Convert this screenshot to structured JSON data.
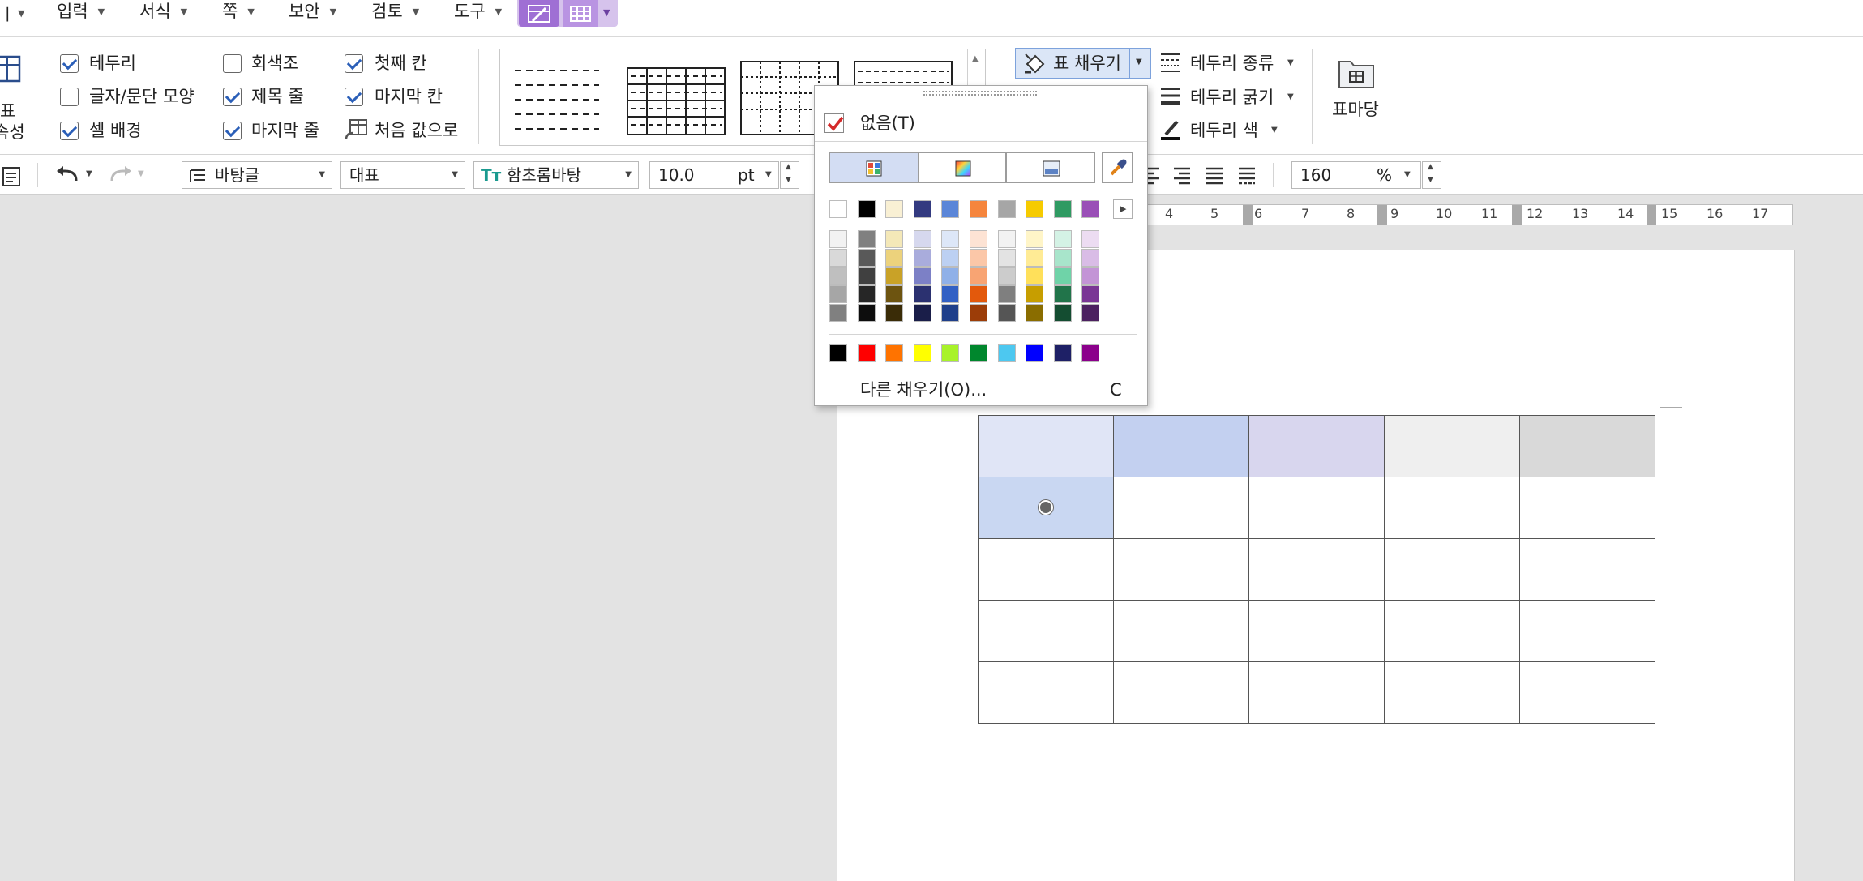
{
  "menu": {
    "items": [
      "입력",
      "서식",
      "쪽",
      "보안",
      "검토",
      "도구"
    ]
  },
  "ribbon": {
    "table_props_label_a": "표",
    "table_props_label_b": "속성",
    "checks": [
      {
        "label": "테두리",
        "checked": true
      },
      {
        "label": "글자/문단 모양",
        "checked": false
      },
      {
        "label": "셀 배경",
        "checked": true
      },
      {
        "label": "회색조",
        "checked": false
      },
      {
        "label": "제목 줄",
        "checked": true
      },
      {
        "label": "마지막 줄",
        "checked": true
      },
      {
        "label": "첫째 칸",
        "checked": true
      },
      {
        "label": "마지막 칸",
        "checked": true
      }
    ],
    "reset_label": "처음 값으로",
    "fill_label": "표 채우기",
    "border_type_label": "테두리 종류",
    "border_width_label": "테두리 굵기",
    "border_color_label": "테두리 색",
    "yard_label": "표마당"
  },
  "toolbar": {
    "style": "바탕글",
    "language": "대표",
    "font": "함초롬바탕",
    "size": "10.0",
    "size_unit": "pt",
    "zoom": "160",
    "zoom_unit": "%"
  },
  "ruler": {
    "labels": [
      "4",
      "5",
      "6",
      "7",
      "8",
      "9",
      "10",
      "11",
      "12",
      "13",
      "14",
      "15",
      "16",
      "17"
    ]
  },
  "popup": {
    "none_label": "없음(T)",
    "none_checked": true,
    "more_label": "다른 채우기(O)...",
    "more_shortcut": "C",
    "top_row": [
      "#ffffff",
      "#000000",
      "#f9f0d4",
      "#333a80",
      "#5b86d8",
      "#f5853d",
      "#a6a6a6",
      "#f6cb00",
      "#2f9a62",
      "#9a4fb7"
    ],
    "shade_columns": [
      [
        "#f2f2f2",
        "#d9d9d9",
        "#bfbfbf",
        "#a6a6a6",
        "#808080"
      ],
      [
        "#808080",
        "#595959",
        "#404040",
        "#262626",
        "#0d0d0d"
      ],
      [
        "#f4e8b8",
        "#ecd27c",
        "#c9a227",
        "#6d5410",
        "#3a2c07"
      ],
      [
        "#d6d8ee",
        "#a9acdc",
        "#7c80c6",
        "#2b3170",
        "#1a1e49"
      ],
      [
        "#dde7f8",
        "#bcd0f2",
        "#8fb0e8",
        "#3260c4",
        "#1f3f8a"
      ],
      [
        "#fde3d4",
        "#fbc7a8",
        "#f8a473",
        "#e3590c",
        "#9c3d08"
      ],
      [
        "#f2f2f2",
        "#e3e3e3",
        "#cccccc",
        "#7f7f7f",
        "#555555"
      ],
      [
        "#fff5c8",
        "#ffeb95",
        "#ffe05a",
        "#c79e00",
        "#8a6d00"
      ],
      [
        "#d4f2e5",
        "#a8e5cb",
        "#6fd3a8",
        "#21744a",
        "#144d31"
      ],
      [
        "#ecdcf2",
        "#d9bce6",
        "#c394d6",
        "#7a3595",
        "#4c2160"
      ]
    ],
    "std_row": [
      "#000000",
      "#ff0000",
      "#ff7300",
      "#ffff00",
      "#a8f229",
      "#00872d",
      "#4dc8f0",
      "#0000ff",
      "#1e2066",
      "#8b008b"
    ]
  },
  "table": {
    "fills": [
      [
        "#e0e5f6",
        "#c3d0f0",
        "#d8d6ee",
        "#efefef",
        "#d9d9d9"
      ],
      [
        "#c9d7f2",
        "",
        "",
        "",
        ""
      ]
    ]
  }
}
